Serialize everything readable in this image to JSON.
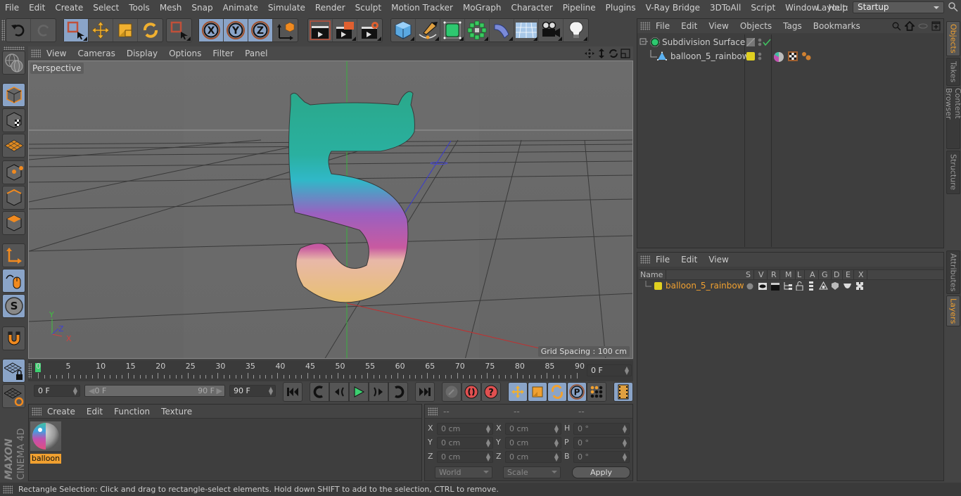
{
  "menu": [
    "File",
    "Edit",
    "Create",
    "Select",
    "Tools",
    "Mesh",
    "Snap",
    "Animate",
    "Simulate",
    "Render",
    "Sculpt",
    "Motion Tracker",
    "MoGraph",
    "Character",
    "Pipeline",
    "Plugins",
    "V-Ray Bridge",
    "3DToAll",
    "Script",
    "Window",
    "Help"
  ],
  "layout": {
    "label": "Layout:",
    "value": "Startup"
  },
  "toolbar": {
    "groups": [
      [
        "undo-icon",
        "redo-icon"
      ],
      [
        "rectangle-selection-icon",
        "move-icon",
        "scale-icon",
        "rotate-icon"
      ],
      [
        "live-selection-icon"
      ],
      [
        "x-axis-icon",
        "y-axis-icon",
        "z-axis-icon",
        "coordinate-system-icon"
      ],
      [
        "render-view-icon",
        "render-picture-viewer-icon",
        "render-settings-icon"
      ],
      [
        "cube-icon",
        "pen-icon",
        "subdivision-surface-icon",
        "cloner-icon",
        "deformer-icon",
        "floor-icon",
        "camera-icon",
        "light-icon"
      ]
    ]
  },
  "viewport": {
    "menu": [
      "View",
      "Cameras",
      "Display",
      "Options",
      "Filter",
      "Panel"
    ],
    "camera_label": "Perspective",
    "grid_spacing": "Grid Spacing : 100 cm",
    "axis_labels": {
      "x": "X",
      "y": "Y",
      "z": "Z"
    }
  },
  "timeline": {
    "ticks": [
      "0",
      "5",
      "10",
      "15",
      "20",
      "25",
      "30",
      "35",
      "40",
      "45",
      "50",
      "55",
      "60",
      "65",
      "70",
      "75",
      "80",
      "85",
      "90"
    ],
    "current_frame": "0 F",
    "start_field": "0 F",
    "range_start": "0 F",
    "range_end": "90 F",
    "end_field": "90 F"
  },
  "material_panel": {
    "menu": [
      "Create",
      "Edit",
      "Function",
      "Texture"
    ],
    "materials": [
      {
        "name": "balloon"
      }
    ]
  },
  "coord_panel": {
    "headers": [
      "--",
      "--",
      "--"
    ],
    "rows": [
      {
        "l1": "X",
        "v1": "0 cm",
        "l2": "X",
        "v2": "0 cm",
        "l3": "H",
        "v3": "0 °"
      },
      {
        "l1": "Y",
        "v1": "0 cm",
        "l2": "Y",
        "v2": "0 cm",
        "l3": "P",
        "v3": "0 °"
      },
      {
        "l1": "Z",
        "v1": "0 cm",
        "l2": "Z",
        "v2": "0 cm",
        "l3": "B",
        "v3": "0 °"
      }
    ],
    "mode": "World",
    "scale_mode": "Scale",
    "apply": "Apply"
  },
  "object_manager": {
    "menu": [
      "File",
      "Edit",
      "View",
      "Objects",
      "Tags",
      "Bookmarks"
    ],
    "objects": [
      {
        "name": "Subdivision Surface"
      },
      {
        "name": "balloon_5_rainbow"
      }
    ]
  },
  "layer_manager": {
    "menu": [
      "File",
      "Edit",
      "View"
    ],
    "columns": [
      "Name",
      "S",
      "V",
      "R",
      "M",
      "L",
      "A",
      "G",
      "D",
      "E",
      "X"
    ],
    "layers": [
      {
        "name": "balloon_5_rainbow",
        "color": "#e8d020"
      }
    ]
  },
  "side_tabs_top": [
    "Objects",
    "Takes",
    "Content Browser",
    "Structure"
  ],
  "side_tabs_bottom": [
    "Attributes",
    "Layers"
  ],
  "status": "Rectangle Selection: Click and drag to rectangle-select elements. Hold down SHIFT to add to the selection, CTRL to remove.",
  "brand": {
    "maker": "MAXON",
    "product": "CINEMA 4D"
  },
  "colors": {
    "accent": "#f0a030",
    "active_button": "#8aa4c8",
    "background": "#444444"
  }
}
